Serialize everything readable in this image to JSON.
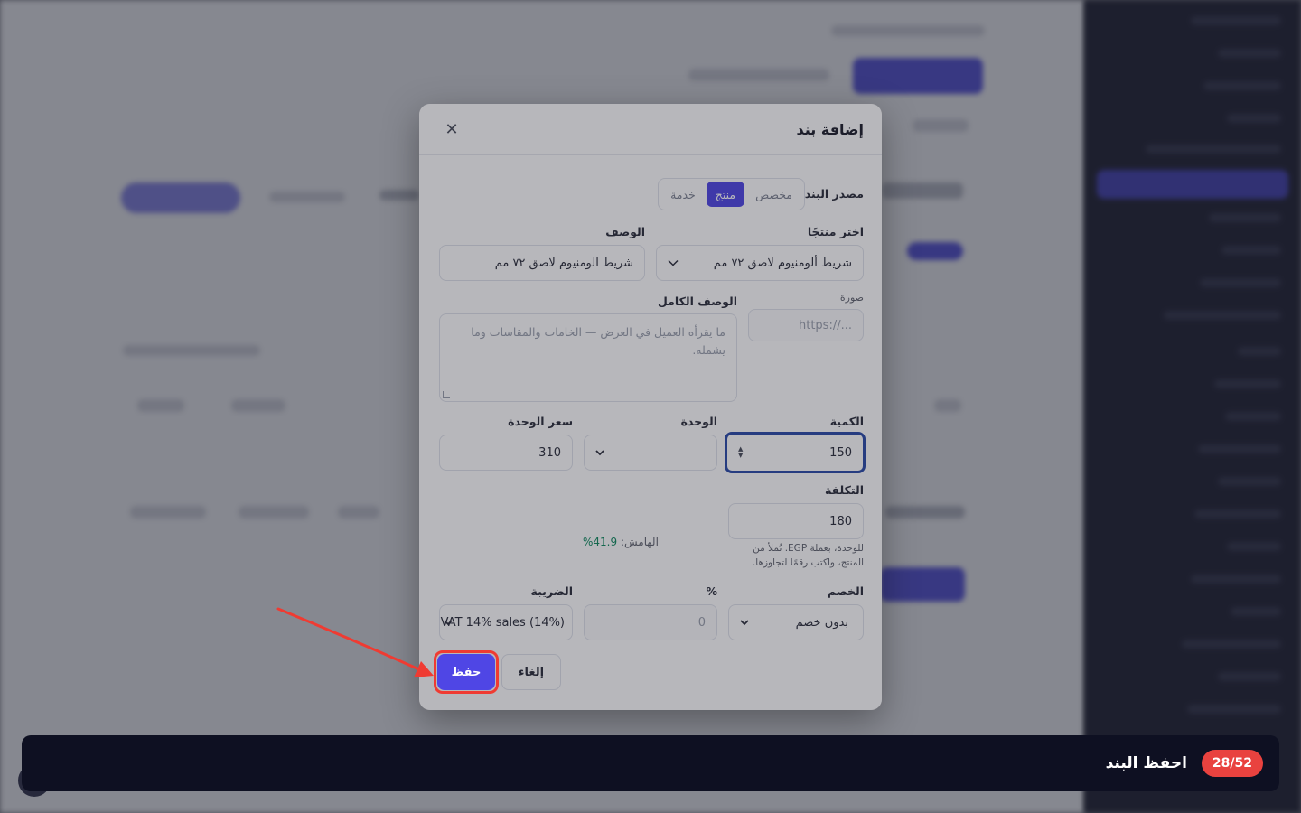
{
  "modal": {
    "title": "إضافة بند",
    "close_icon": "close-icon",
    "source_label": "مصدر البند",
    "source_options": [
      "مخصص",
      "منتج",
      "خدمة"
    ],
    "source_selected": "منتج",
    "product_label": "اختر منتجًا",
    "product_value": "شريط ألومنيوم لاصق ٧٢ مم",
    "description_label": "الوصف",
    "description_value": "شريط الومنيوم لاصق ٧٢ مم",
    "image_label": "صورة",
    "image_placeholder": "https://...",
    "full_description_label": "الوصف الكامل",
    "full_description_placeholder": "ما يقرأه العميل في العرض — الخامات والمقاسات وما يشمله.",
    "quantity_label": "الكمية",
    "quantity_value": "150",
    "unit_label": "الوحدة",
    "unit_value": "—",
    "unit_price_label": "سعر الوحدة",
    "unit_price_value": "310",
    "cost_label": "التكلفة",
    "cost_value": "180",
    "cost_hint": "للوحدة، بعملة EGP. تُملأ من المنتج، واكتب رقمًا لتجاوزها.",
    "margin_label": "الهامش:",
    "margin_value": "41.9%",
    "discount_label": "الخصم",
    "discount_value": "بدون خصم",
    "percent_label": "%",
    "percent_placeholder": "0",
    "tax_label": "الضريبة",
    "tax_value": "VAT 14% sales (14%)",
    "cancel_label": "إلغاء",
    "save_label": "حفظ"
  },
  "stepbar": {
    "badge": "28/52",
    "instruction": "احفظ البند"
  },
  "colors": {
    "primary": "#4f46e5",
    "highlight": "#ef3b32",
    "margin_positive": "#0f8a5f"
  }
}
